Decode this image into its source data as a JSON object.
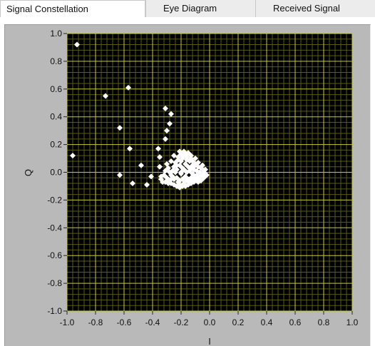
{
  "tabs": [
    {
      "label": "Signal Constellation",
      "active": true
    },
    {
      "label": "Eye Diagram",
      "active": false
    },
    {
      "label": "Received Signal",
      "active": false
    }
  ],
  "colors": {
    "plot_background": "#000000",
    "grid_major": "#c8c832",
    "grid_minor": "#5a5a14",
    "points": "#ffffff",
    "frame": "#b9b9b9"
  },
  "chart_data": {
    "type": "scatter",
    "title": "",
    "xlabel": "I",
    "ylabel": "Q",
    "xlim": [
      -1.0,
      1.0
    ],
    "ylim": [
      -1.0,
      1.0
    ],
    "x_ticks": [
      "-1.0",
      "-0.8",
      "-0.6",
      "-0.4",
      "-0.2",
      "0.0",
      "0.2",
      "0.4",
      "0.6",
      "0.8",
      "1.0"
    ],
    "y_ticks": [
      "1.0",
      "0.8",
      "0.6",
      "0.4",
      "0.2",
      "0.0",
      "-0.2",
      "-0.4",
      "-0.6",
      "-0.8",
      "-1.0"
    ],
    "grid": true,
    "series": [
      {
        "points": [
          [
            -0.93,
            0.92
          ],
          [
            -0.73,
            0.55
          ],
          [
            -0.57,
            0.61
          ],
          [
            -0.63,
            0.32
          ],
          [
            -0.96,
            0.12
          ],
          [
            -0.63,
            -0.02
          ],
          [
            -0.56,
            0.17
          ],
          [
            -0.54,
            -0.08
          ],
          [
            -0.48,
            0.05
          ],
          [
            -0.44,
            -0.09
          ],
          [
            -0.41,
            -0.03
          ],
          [
            -0.36,
            0.17
          ],
          [
            -0.35,
            0.11
          ],
          [
            -0.35,
            0.04
          ],
          [
            -0.34,
            -0.03
          ],
          [
            -0.31,
            0.46
          ],
          [
            -0.27,
            0.42
          ],
          [
            -0.28,
            0.35
          ],
          [
            -0.3,
            0.3
          ],
          [
            -0.31,
            0.24
          ],
          [
            -0.25,
            0.12
          ],
          [
            -0.21,
            0.15
          ],
          [
            -0.18,
            0.15
          ],
          [
            -0.15,
            0.14
          ],
          [
            -0.13,
            0.12
          ],
          [
            -0.3,
            0.06
          ],
          [
            -0.27,
            0.08
          ],
          [
            -0.22,
            0.09
          ],
          [
            -0.19,
            0.1
          ],
          [
            -0.16,
            0.09
          ],
          [
            -0.12,
            0.08
          ],
          [
            -0.1,
            0.06
          ],
          [
            -0.08,
            0.04
          ],
          [
            -0.06,
            0.03
          ],
          [
            -0.04,
            0.01
          ],
          [
            -0.03,
            -0.01
          ],
          [
            -0.05,
            -0.03
          ],
          [
            -0.07,
            -0.05
          ],
          [
            -0.09,
            -0.06
          ],
          [
            -0.11,
            -0.07
          ],
          [
            -0.13,
            -0.08
          ],
          [
            -0.15,
            -0.09
          ],
          [
            -0.17,
            -0.1
          ],
          [
            -0.19,
            -0.1
          ],
          [
            -0.21,
            -0.11
          ],
          [
            -0.23,
            -0.1
          ],
          [
            -0.25,
            -0.09
          ],
          [
            -0.27,
            -0.08
          ],
          [
            -0.29,
            -0.08
          ],
          [
            -0.31,
            -0.07
          ],
          [
            -0.33,
            -0.07
          ],
          [
            -0.31,
            0.01
          ],
          [
            -0.29,
            0.03
          ],
          [
            -0.27,
            -0.02
          ],
          [
            -0.25,
            0.04
          ],
          [
            -0.23,
            0.02
          ],
          [
            -0.21,
            0.05
          ],
          [
            -0.19,
            0.03
          ],
          [
            -0.17,
            0.06
          ],
          [
            -0.15,
            0.04
          ],
          [
            -0.13,
            0.03
          ],
          [
            -0.11,
            0.02
          ],
          [
            -0.09,
            0.01
          ],
          [
            -0.07,
            0.0
          ],
          [
            -0.05,
            -0.02
          ],
          [
            -0.23,
            -0.04
          ],
          [
            -0.21,
            -0.06
          ],
          [
            -0.19,
            -0.05
          ],
          [
            -0.17,
            -0.03
          ],
          [
            -0.15,
            -0.05
          ],
          [
            -0.13,
            -0.04
          ],
          [
            -0.11,
            -0.03
          ],
          [
            -0.09,
            -0.02
          ],
          [
            -0.07,
            -0.03
          ],
          [
            -0.25,
            -0.05
          ],
          [
            -0.27,
            -0.05
          ],
          [
            -0.24,
            0.0
          ],
          [
            -0.2,
            -0.01
          ],
          [
            -0.16,
            0.0
          ],
          [
            -0.12,
            -0.01
          ],
          [
            -0.08,
            -0.04
          ],
          [
            -0.18,
            -0.08
          ],
          [
            -0.14,
            -0.07
          ],
          [
            -0.1,
            -0.05
          ],
          [
            -0.22,
            -0.07
          ],
          [
            -0.26,
            0.01
          ],
          [
            -0.2,
            0.08
          ],
          [
            -0.16,
            0.11
          ],
          [
            -0.12,
            0.05
          ],
          [
            -0.14,
            0.08
          ],
          [
            -0.18,
            0.12
          ],
          [
            -0.22,
            0.11
          ],
          [
            -0.24,
            0.07
          ],
          [
            -0.28,
            0.0
          ],
          [
            -0.3,
            -0.04
          ],
          [
            -0.32,
            -0.02
          ],
          [
            -0.34,
            -0.05
          ],
          [
            -0.06,
            -0.06
          ],
          [
            -0.04,
            -0.04
          ],
          [
            -0.02,
            -0.02
          ],
          [
            -0.03,
            0.02
          ],
          [
            -0.05,
            0.05
          ],
          [
            -0.08,
            0.07
          ],
          [
            -0.1,
            0.1
          ],
          [
            -0.13,
            0.1
          ],
          [
            -0.17,
            0.13
          ],
          [
            -0.2,
            0.13
          ],
          [
            -0.23,
            0.05
          ],
          [
            -0.26,
            -0.03
          ],
          [
            -0.29,
            -0.06
          ],
          [
            -0.21,
            -0.09
          ],
          [
            -0.16,
            -0.06
          ],
          [
            -0.12,
            -0.06
          ],
          [
            -0.08,
            -0.07
          ],
          [
            -0.2,
            0.0
          ],
          [
            -0.14,
            0.01
          ],
          [
            -0.18,
            0.02
          ],
          [
            -0.11,
            0.04
          ],
          [
            -0.09,
            -0.04
          ]
        ]
      }
    ]
  }
}
